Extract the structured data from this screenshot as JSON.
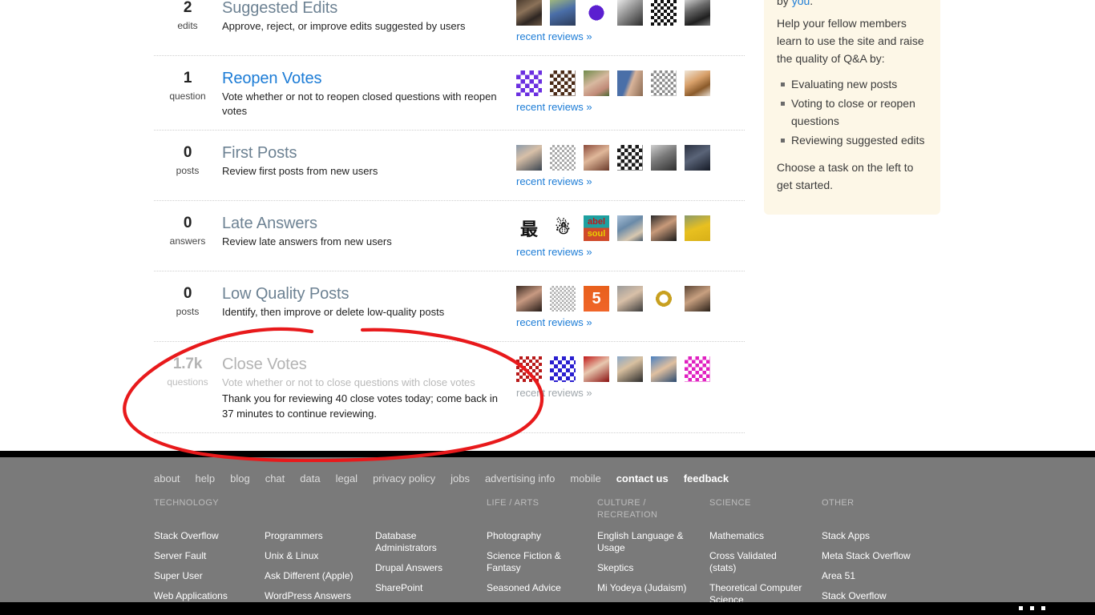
{
  "queues": [
    {
      "count": "2",
      "unit": "edits",
      "title": "Suggested Edits",
      "title_state": "muted",
      "description": "Approve, reject, or improve edits suggested by users",
      "note": "",
      "recent_label": "recent reviews »",
      "recent_state": "active",
      "avatars": [
        "photo-man-dark",
        "photo-man-blue-shirt",
        "identicon-purple-star",
        "photo-bw-portrait",
        "identicon-black-dense",
        "photo-man-tshirt"
      ]
    },
    {
      "count": "1",
      "unit": "question",
      "title": "Reopen Votes",
      "title_state": "active",
      "description": "Vote whether or not to reopen closed questions with reopen votes",
      "note": "",
      "recent_label": "recent reviews »",
      "recent_state": "active",
      "avatars": [
        "identicon-purple-x",
        "identicon-brown-grid",
        "photo-shouting-child",
        "photo-man-glasses",
        "identicon-grey-weave",
        "photo-cat"
      ]
    },
    {
      "count": "0",
      "unit": "posts",
      "title": "First Posts",
      "title_state": "muted",
      "description": "Review first posts from new users",
      "note": "",
      "recent_label": "recent reviews »",
      "recent_state": "active",
      "avatars": [
        "photo-man-suit",
        "identicon-grey-dots",
        "photo-man-smiling",
        "identicon-black-weave",
        "photo-man-bw",
        "photo-man-dark-bg"
      ]
    },
    {
      "count": "0",
      "unit": "answers",
      "title": "Late Answers",
      "title_state": "muted",
      "description": "Review late answers from new users",
      "note": "",
      "recent_label": "recent reviews »",
      "recent_state": "active",
      "avatars": [
        "kanji-zui",
        "drawing-gnome",
        "logo-abel-soul",
        "photo-office",
        "photo-man-face",
        "photo-man-yellow-shirt"
      ]
    },
    {
      "count": "0",
      "unit": "posts",
      "title": "Low Quality Posts",
      "title_state": "muted",
      "description": "Identify, then improve or delete low-quality posts",
      "note": "",
      "recent_label": "recent reviews »",
      "recent_state": "active",
      "avatars": [
        "photo-woman-dark",
        "identicon-grey-fine",
        "logo-html5",
        "photo-man-grey",
        "identicon-gold-ring",
        "photo-man-brown"
      ]
    },
    {
      "count": "1.7k",
      "unit": "questions",
      "title": "Close Votes",
      "title_state": "disabled",
      "description": "Vote whether or not to close questions with close votes",
      "note": "Thank you for reviewing 40 close votes today; come back in 37 minutes to continue reviewing.",
      "recent_label": "recent reviews »",
      "recent_state": "disabled",
      "avatars": [
        "identicon-red-dense",
        "identicon-blue-blocky",
        "photo-man-red-bg",
        "photo-man-outdoor",
        "photo-man-blue-bg",
        "identicon-magenta"
      ]
    }
  ],
  "sidebar": {
    "lead_cut_prefix": "by ",
    "lead_cut_link": "you",
    "lead_cut_suffix": ".",
    "intro": "Help your fellow members learn to use the site and raise the quality of Q&A by:",
    "bullets": [
      "Evaluating new posts",
      "Voting to close or reopen questions",
      "Reviewing suggested edits"
    ],
    "closing": "Choose a task on the left to get started."
  },
  "footer": {
    "top_links": [
      {
        "label": "about",
        "strong": false
      },
      {
        "label": "help",
        "strong": false
      },
      {
        "label": "blog",
        "strong": false
      },
      {
        "label": "chat",
        "strong": false
      },
      {
        "label": "data",
        "strong": false
      },
      {
        "label": "legal",
        "strong": false
      },
      {
        "label": "privacy policy",
        "strong": false
      },
      {
        "label": "jobs",
        "strong": false
      },
      {
        "label": "advertising info",
        "strong": false
      },
      {
        "label": "mobile",
        "strong": false
      },
      {
        "label": "contact us",
        "strong": true
      },
      {
        "label": "feedback",
        "strong": true
      }
    ],
    "categories": [
      {
        "id": "technology",
        "heading": "TECHNOLOGY",
        "subcolumns": [
          [
            "Stack Overflow",
            "Server Fault",
            "Super User",
            "Web Applications"
          ],
          [
            "Programmers",
            "Unix & Linux",
            "Ask Different (Apple)",
            "WordPress Answers"
          ],
          [
            "Database Administrators",
            "Drupal Answers",
            "SharePoint"
          ]
        ]
      },
      {
        "id": "life",
        "heading": "LIFE / ARTS",
        "subcolumns": [
          [
            "Photography",
            "Science Fiction & Fantasy",
            "Seasoned Advice"
          ]
        ]
      },
      {
        "id": "culture",
        "heading": "CULTURE /\nRECREATION",
        "subcolumns": [
          [
            "English Language & Usage",
            "Skeptics",
            "Mi Yodeya (Judaism)"
          ]
        ]
      },
      {
        "id": "science",
        "heading": "SCIENCE",
        "subcolumns": [
          [
            "Mathematics",
            "Cross Validated (stats)",
            "Theoretical Computer Science"
          ]
        ]
      },
      {
        "id": "other",
        "heading": "OTHER",
        "subcolumns": [
          [
            "Stack Apps",
            "Meta Stack Overflow",
            "Area 51",
            "Stack Overflow"
          ]
        ]
      }
    ]
  },
  "annotation": {
    "type": "hand-drawn-ellipse",
    "color": "#e8191b",
    "targets": "Close Votes queue row"
  },
  "colors": {
    "link_blue": "#1c7cd6",
    "title_muted": "#6d8293",
    "disabled_grey": "#b3b3b3",
    "sidebar_bg": "#fdf7e7",
    "footer_bg": "#7a7a7a",
    "annotation_red": "#e8191b"
  }
}
